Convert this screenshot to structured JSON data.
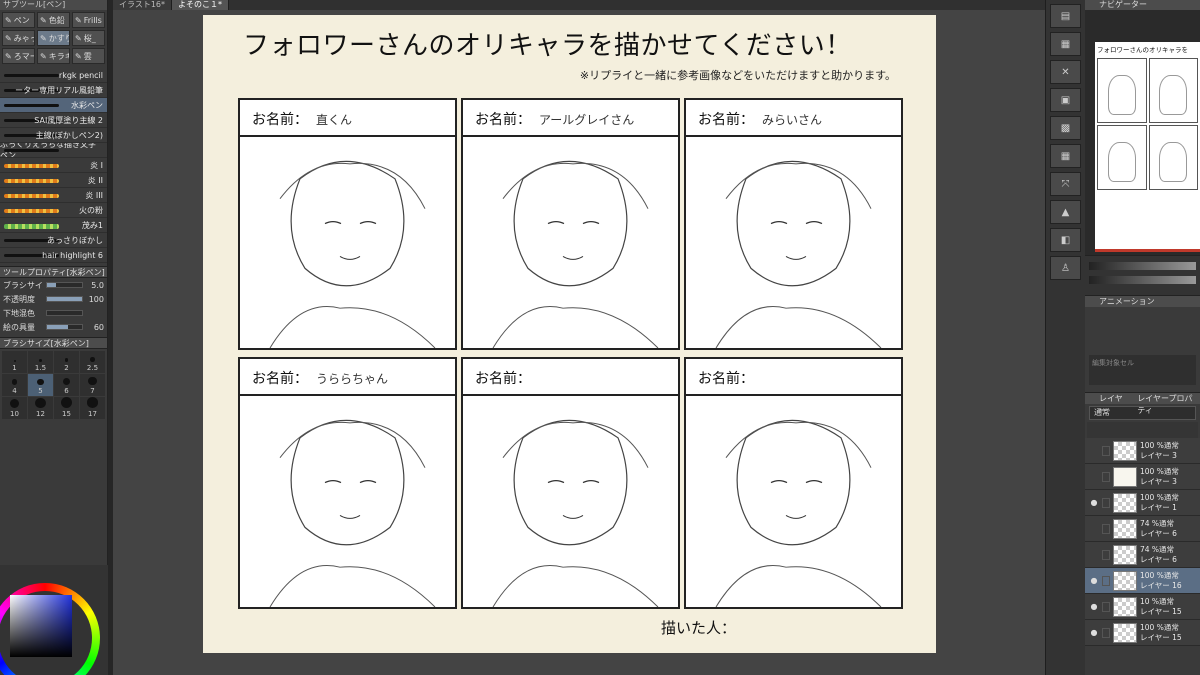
{
  "tabs": [
    "イラスト16*",
    "よそのこ１*"
  ],
  "left": {
    "header": "サブツール[ペン]",
    "subtools": [
      {
        "label": "ペン",
        "icon": "pen-icon"
      },
      {
        "label": "色鉛",
        "icon": "pencil-icon"
      },
      {
        "label": "Frills",
        "icon": "brush-icon"
      },
      {
        "label": "みゃっ",
        "icon": "brush-icon"
      },
      {
        "label": "かすり",
        "icon": "brush-icon"
      },
      {
        "label": "桜_",
        "icon": "brush-icon"
      },
      {
        "label": "ろマー",
        "icon": "brush-icon"
      },
      {
        "label": "キラキ",
        "icon": "sparkle-icon"
      },
      {
        "label": "雲",
        "icon": "cloud-icon"
      }
    ],
    "brushes": [
      {
        "label": "rkgk pencil",
        "kind": "line"
      },
      {
        "label": "ーター専用リアル風鉛筆",
        "kind": "line"
      },
      {
        "label": "水彩ペン",
        "kind": "line"
      },
      {
        "label": "SAI風厚塗り主線 2",
        "kind": "line"
      },
      {
        "label": "主線(ぼかしペン2)",
        "kind": "line"
      },
      {
        "label": "ぷっくりえっちな描き文字ペン",
        "kind": "line"
      },
      {
        "label": "炎 I",
        "kind": "fire"
      },
      {
        "label": "炎 II",
        "kind": "fire"
      },
      {
        "label": "炎 III",
        "kind": "fire"
      },
      {
        "label": "火の粉",
        "kind": "fire"
      },
      {
        "label": "茂み1",
        "kind": "green"
      },
      {
        "label": "あっさりぼかし",
        "kind": "line"
      },
      {
        "label": "hair highlight 6",
        "kind": "line"
      }
    ],
    "selected_brush_index": 2,
    "tool_property_title": "ツールプロパティ[水彩ペン]",
    "props": [
      {
        "label": "ブラシサイズ",
        "value": "5.0",
        "level": 0.25
      },
      {
        "label": "不透明度",
        "value": "100",
        "level": 1.0
      },
      {
        "label": "下地混色",
        "value": "",
        "level": 0
      },
      {
        "label": "絵の具量",
        "value": "60",
        "level": 0.6
      }
    ],
    "brush_size_title": "ブラシサイズ[水彩ペン]",
    "sizes": [
      "1",
      "1.5",
      "2",
      "2.5",
      "4",
      "5",
      "6",
      "7",
      "10",
      "12",
      "15",
      "17"
    ],
    "selected_size": "5"
  },
  "canvas": {
    "title": "フォロワーさんのオリキャラを描かせてください！",
    "subtitle": "※リプライと一緒に参考画像などをいただけますと助かります。",
    "name_label": "お名前：",
    "frames": [
      {
        "handwritten": "直くん"
      },
      {
        "handwritten": "アールグレイさん"
      },
      {
        "handwritten": "みらいさん"
      },
      {
        "handwritten": "うららちゃん"
      },
      {
        "handwritten": ""
      },
      {
        "handwritten": ""
      }
    ],
    "drawn_by": "描いた人："
  },
  "right": {
    "navigator_title": "ナビゲーター",
    "navigator_mini_title": "フォロワーさんのオリキャラを",
    "animation_title": "アニメーション",
    "animation_note": "編集対象セル",
    "layer_tab": "レイヤー",
    "layer_tab2": "レイヤープロパティ",
    "blend_mode": "通常",
    "layers": [
      {
        "mode": "100 %通常",
        "name": "レイヤー 3",
        "visible": false,
        "art": false
      },
      {
        "mode": "100 %通常",
        "name": "レイヤー 3",
        "visible": false,
        "art": true
      },
      {
        "mode": "100 %通常",
        "name": "レイヤー 1",
        "visible": true,
        "art": false
      },
      {
        "mode": "74 %通常",
        "name": "レイヤー 6",
        "visible": false,
        "art": false
      },
      {
        "mode": "74 %通常",
        "name": "レイヤー 6",
        "visible": false,
        "art": false
      },
      {
        "mode": "100 %通常",
        "name": "レイヤー 16",
        "visible": true,
        "art": false
      },
      {
        "mode": "10 %通常",
        "name": "レイヤー 15",
        "visible": true,
        "art": false
      },
      {
        "mode": "100 %通常",
        "name": "レイヤー 15",
        "visible": true,
        "art": false
      }
    ],
    "selected_layer_index": 5
  }
}
